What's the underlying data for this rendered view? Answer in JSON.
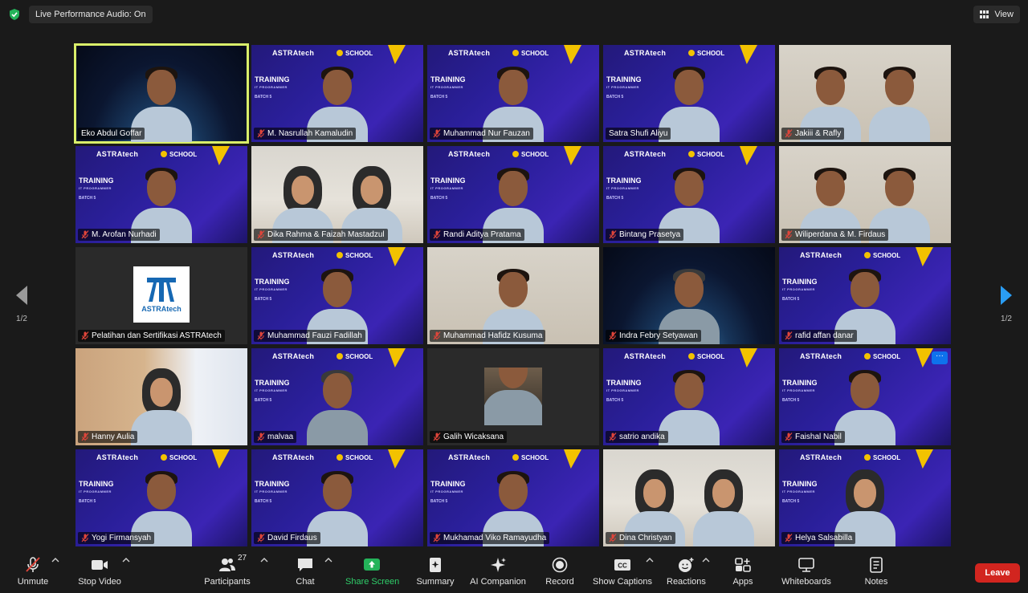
{
  "topbar": {
    "live_audio": "Live Performance Audio: On",
    "view_label": "View"
  },
  "branding": {
    "brand": "ASTRAtech",
    "school": "SCHOOL",
    "training": "TRAINING",
    "training_sub": "IT PROGRAMMER",
    "batch": "BATCH 5",
    "accent": "#f2c200",
    "active_border": "#d9ee6a"
  },
  "participants": [
    {
      "name": "Eko Abdul Goffar",
      "muted": false,
      "bg": "space",
      "active": true
    },
    {
      "name": "M. Nasrullah Kamaludin",
      "muted": true,
      "bg": "astra"
    },
    {
      "name": "Muhammad Nur Fauzan",
      "muted": true,
      "bg": "astra"
    },
    {
      "name": "Satra Shufi Aliyu",
      "muted": false,
      "bg": "astra"
    },
    {
      "name": "Jakiii & Rafly",
      "muted": true,
      "bg": "wall",
      "people": 2
    },
    {
      "name": "M. Arofan Nurhadi",
      "muted": true,
      "bg": "astra"
    },
    {
      "name": "Dika Rahma & Faizah Mastadzul",
      "muted": true,
      "bg": "room",
      "people": 2,
      "hijab": true
    },
    {
      "name": "Randi Aditya Pratama",
      "muted": true,
      "bg": "astra"
    },
    {
      "name": "Bintang Prasetya",
      "muted": true,
      "bg": "astra"
    },
    {
      "name": "Wiliperdana & M. Firdaus",
      "muted": true,
      "bg": "wall",
      "people": 2
    },
    {
      "name": "Pelatihan dan Sertifikasi ASTRAtech",
      "muted": true,
      "bg": "logo",
      "logo_text": "ASTRAtech"
    },
    {
      "name": "Muhammad Fauzi Fadillah",
      "muted": true,
      "bg": "astra"
    },
    {
      "name": "Muhammad Hafidz Kusuma",
      "muted": true,
      "bg": "wall"
    },
    {
      "name": "Indra Febry Setyawan",
      "muted": true,
      "bg": "space",
      "grey": true
    },
    {
      "name": "rafid affan danar",
      "muted": true,
      "bg": "astra"
    },
    {
      "name": "Hanny Aulia",
      "muted": true,
      "bg": "office",
      "hijab": true
    },
    {
      "name": "malvaa",
      "muted": true,
      "bg": "astra",
      "grey": true
    },
    {
      "name": "Galih Wicaksana",
      "muted": true,
      "bg": "photo"
    },
    {
      "name": "satrio andika",
      "muted": true,
      "bg": "astra"
    },
    {
      "name": "Faishal Nabil",
      "muted": true,
      "bg": "astra",
      "more": true
    },
    {
      "name": "Yogi Firmansyah",
      "muted": true,
      "bg": "astra"
    },
    {
      "name": "David Firdaus",
      "muted": true,
      "bg": "astra"
    },
    {
      "name": "Mukhamad Viko Ramayudha",
      "muted": true,
      "bg": "astra"
    },
    {
      "name": "Dina Christyan",
      "muted": true,
      "bg": "room",
      "people": 2,
      "hijab": true
    },
    {
      "name": "Helya Salsabilla",
      "muted": true,
      "bg": "astra",
      "hijab": true
    }
  ],
  "pagination": {
    "left": "1/2",
    "right": "1/2"
  },
  "toolbar": {
    "unmute": "Unmute",
    "stop_video": "Stop Video",
    "participants": "Participants",
    "participants_count": "27",
    "chat": "Chat",
    "share_screen": "Share Screen",
    "summary": "Summary",
    "ai_companion": "AI Companion",
    "record": "Record",
    "show_captions": "Show Captions",
    "reactions": "Reactions",
    "apps": "Apps",
    "whiteboards": "Whiteboards",
    "notes": "Notes",
    "leave": "Leave",
    "more_badge": "···"
  }
}
